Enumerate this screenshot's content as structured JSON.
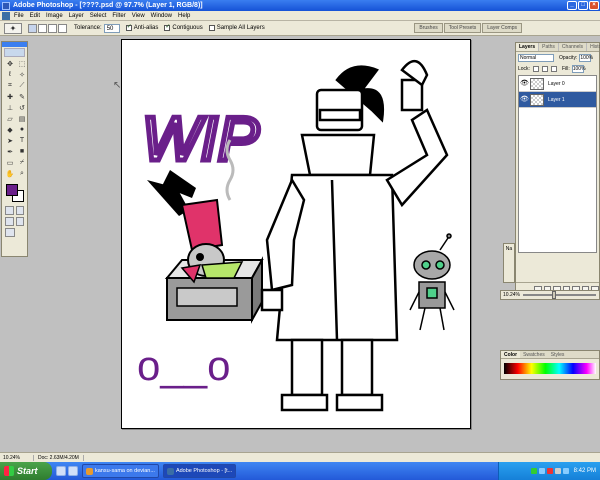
{
  "window": {
    "title": "Adobe Photoshop - [????.psd @ 97.7% (Layer 1, RGB/8)]",
    "controls": [
      "_",
      "□",
      "×"
    ]
  },
  "menubar": {
    "items": [
      "File",
      "Edit",
      "Image",
      "Layer",
      "Select",
      "Filter",
      "View",
      "Window",
      "Help"
    ]
  },
  "options": {
    "tolerance_label": "Tolerance:",
    "tolerance_value": "50",
    "antialias_label": "Anti-alias",
    "contiguous_label": "Contiguous",
    "sample_all_label": "Sample All Layers",
    "palette_well": [
      "Brushes",
      "Tool Presets",
      "Layer Comps"
    ]
  },
  "toolbox": {
    "foreground_color": "#6a1f8a",
    "background_color": "#ffffff",
    "tools": [
      "move",
      "marquee",
      "lasso",
      "magic-wand",
      "crop",
      "slice",
      "healing",
      "brush",
      "stamp",
      "history",
      "eraser",
      "gradient",
      "blur",
      "dodge",
      "path-select",
      "type",
      "pen",
      "shape",
      "notes",
      "eyedropper",
      "hand",
      "zoom"
    ]
  },
  "canvas": {
    "wip_text": "WIP",
    "face_text": "o__o"
  },
  "layers_panel": {
    "tabs": [
      "Layers",
      "Paths",
      "Channels",
      "History"
    ],
    "blend_mode": "Normal",
    "opacity_label": "Opacity:",
    "opacity_value": "100%",
    "lock_label": "Lock:",
    "fill_label": "Fill:",
    "fill_value": "100%",
    "layers": [
      {
        "name": "Layer 0",
        "visible": true,
        "selected": false
      },
      {
        "name": "Layer 1",
        "visible": true,
        "selected": true
      }
    ]
  },
  "side_tab": {
    "label": "Na"
  },
  "navigator": {
    "zoom": "10.24%"
  },
  "color_panel": {
    "tabs": [
      "Color",
      "Swatches",
      "Styles"
    ]
  },
  "statusbar": {
    "zoom": "10.24%",
    "doc": "Doc: 2.63M/4.20M"
  },
  "taskbar": {
    "start_label": "Start",
    "tasks": [
      {
        "label": "kansu-sama on devian...",
        "active": false
      },
      {
        "label": "Adobe Photoshop - [t...",
        "active": true
      }
    ],
    "clock": "8:42 PM"
  }
}
